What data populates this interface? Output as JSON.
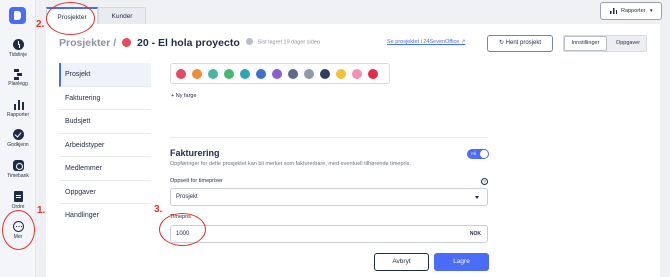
{
  "sidebar": {
    "items": [
      {
        "label": "Tidslinje",
        "icon": "clock-icon"
      },
      {
        "label": "Planlegg",
        "icon": "planner-icon"
      },
      {
        "label": "Rapporter",
        "icon": "bar-chart-icon"
      },
      {
        "label": "Godkjenn",
        "icon": "check-circle-icon"
      },
      {
        "label": "Timebank",
        "icon": "timebank-icon"
      },
      {
        "label": "Ordre",
        "icon": "document-icon"
      },
      {
        "label": "Mer",
        "icon": "more-icon"
      }
    ]
  },
  "tabs": [
    {
      "label": "Prosjekter",
      "active": true
    },
    {
      "label": "Kunder",
      "active": false
    }
  ],
  "reports_button": {
    "label": "Rapporter"
  },
  "header": {
    "breadcrumb_root": "Prosjekter /",
    "project_title": "20 - El hola proyecto",
    "project_color": "#e8495f",
    "saved_status": "Sist lagret 19 dager siden",
    "external_link": "Se prosjektet i 24SevenOffice",
    "fetch_button": "Hent prosjekt",
    "view_toggle": {
      "settings": "Innstillinger",
      "tasks": "Oppgaver"
    }
  },
  "settings_nav": {
    "active": "Prosjekt",
    "items": [
      "Prosjekt",
      "Fakturering",
      "Budsjett",
      "Arbeidstyper",
      "Medlemmer",
      "Oppgaver",
      "Handlinger"
    ]
  },
  "colors": {
    "swatches": [
      "#e8495f",
      "#f28c3b",
      "#4bb5a5",
      "#43b872",
      "#2fa7b3",
      "#3f6fd1",
      "#8a5cd6",
      "#5c6a86",
      "#8f9aa9",
      "#2f3e5c",
      "#f2c236",
      "#f48fb1",
      "#e02d4a"
    ],
    "new_color_label": "Ny farge"
  },
  "billing": {
    "title": "Fakturering",
    "toggle_label": "PÅ",
    "toggle_on": true,
    "description": "Oppføringer for dette prosjektet kan bli merket som fakturerbare, med eventuell tilhørende timepris.",
    "rate_setup_label": "Oppsett for timepriser",
    "rate_setup_value": "Prosjekt",
    "hourly_rate_label": "Timepris",
    "hourly_rate_value": "1000",
    "currency": "NOK"
  },
  "actions": {
    "cancel": "Avbryt",
    "save": "Lagre"
  },
  "annotations": {
    "one": "1.",
    "two": "2.",
    "three": "3."
  }
}
